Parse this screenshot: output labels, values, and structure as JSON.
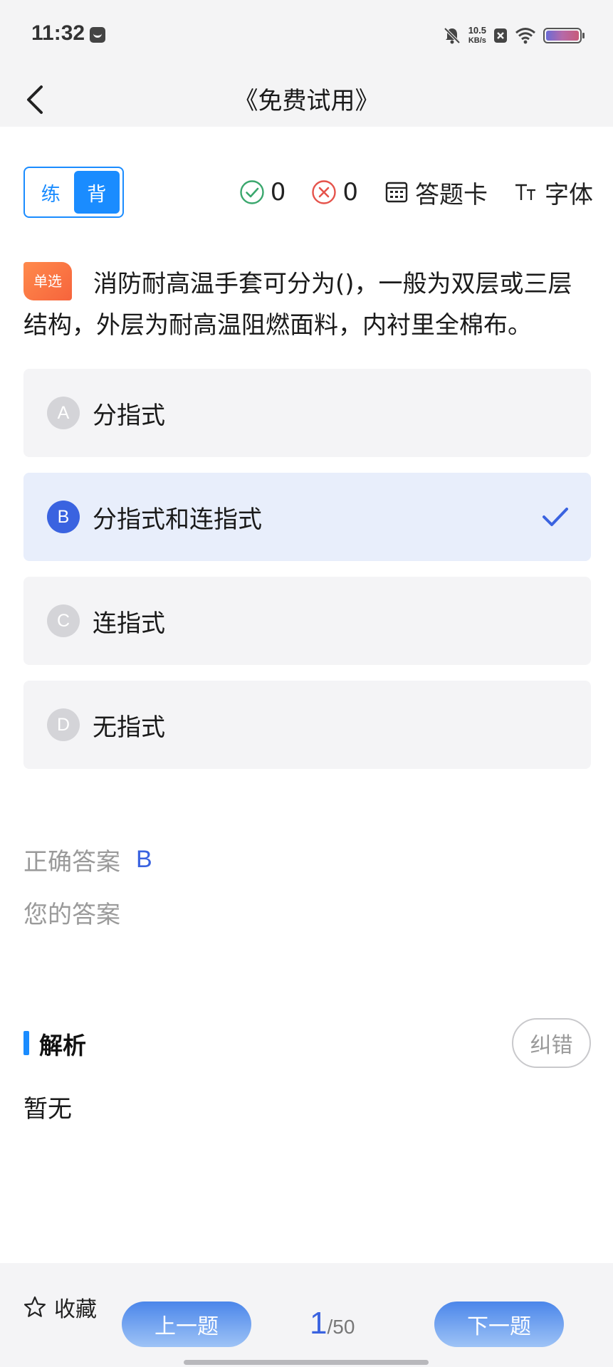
{
  "status_bar": {
    "time": "11:32",
    "net_speed": "10.5",
    "net_unit": "KB/s"
  },
  "header": {
    "title": "《免费试用》"
  },
  "toolbar": {
    "mode_practice": "练",
    "mode_recite": "背",
    "correct_count": "0",
    "wrong_count": "0",
    "answer_card_label": "答题卡",
    "font_label": "字体",
    "font_icon_glyph": "TT"
  },
  "question": {
    "type_tag": "单选",
    "text": "消防耐高温手套可分为()，一般为双层或三层结构，外层为耐高温阻燃面料，内衬里全棉布。",
    "options": [
      {
        "letter": "A",
        "text": "分指式"
      },
      {
        "letter": "B",
        "text": "分指式和连指式"
      },
      {
        "letter": "C",
        "text": "连指式"
      },
      {
        "letter": "D",
        "text": "无指式"
      }
    ],
    "selected": "B"
  },
  "answers": {
    "correct_label": "正确答案",
    "correct_value": "B",
    "yours_label": "您的答案",
    "yours_value": ""
  },
  "analysis": {
    "title": "解析",
    "report_label": "纠错",
    "body": "暂无"
  },
  "bottom": {
    "favorite_label": "收藏",
    "prev_label": "上一题",
    "next_label": "下一题",
    "current_page": "1",
    "total_pages": "/50"
  },
  "colors": {
    "accent": "#1a8cff",
    "selected_bg": "#e8eefb",
    "option_bg": "#f4f4f6",
    "tag": "#f6643c"
  }
}
